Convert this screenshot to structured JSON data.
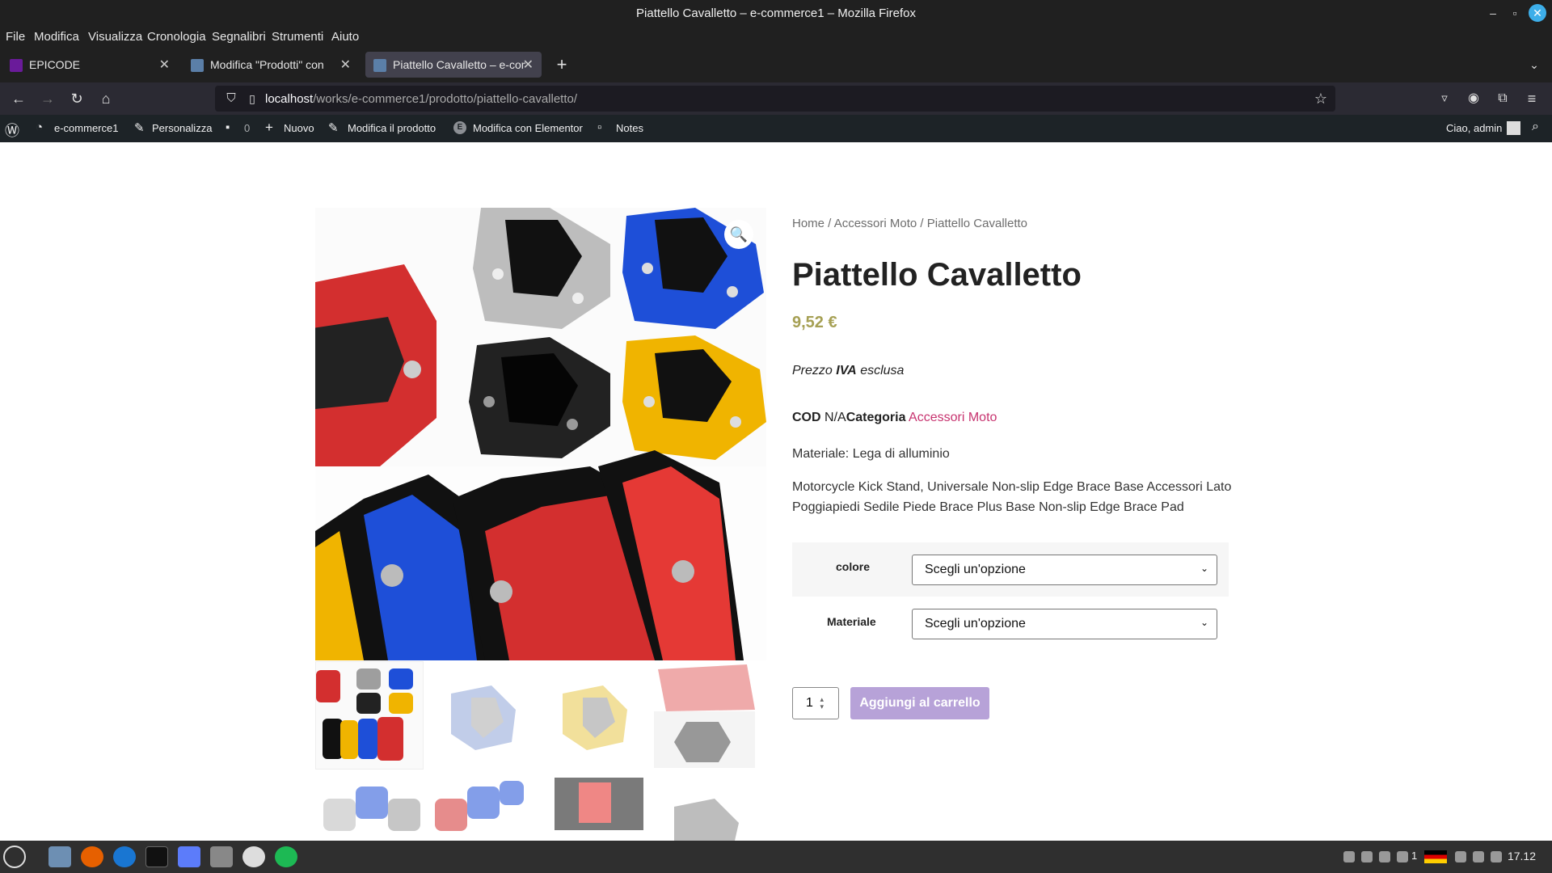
{
  "window": {
    "title": "Piattello Cavalletto – e-commerce1 – Mozilla Firefox"
  },
  "menu": [
    "File",
    "Modifica",
    "Visualizza",
    "Cronologia",
    "Segnalibri",
    "Strumenti",
    "Aiuto"
  ],
  "tabs": [
    {
      "label": "EPICODE"
    },
    {
      "label": "Modifica \"Prodotti\" con Ele"
    },
    {
      "label": "Piattello Cavalletto – e-com"
    }
  ],
  "url": {
    "host": "localhost",
    "path": "/works/e-commerce1/prodotto/piattello-cavalletto/"
  },
  "wpbar": {
    "site": "e-commerce1",
    "customize": "Personalizza",
    "comments": "0",
    "new": "Nuovo",
    "edit_product": "Modifica il prodotto",
    "elementor": "Modifica con Elementor",
    "notes": "Notes",
    "greeting": "Ciao, admin"
  },
  "product": {
    "breadcrumb": [
      "Home",
      "Accessori Moto",
      "Piattello Cavalletto"
    ],
    "title": "Piattello Cavalletto",
    "price": "9,52 €",
    "vat_prefix": "Prezzo",
    "vat_bold": "IVA",
    "vat_suffix": "esclusa",
    "sku_label": "COD",
    "sku_value": "N/A",
    "category_label": "Categoria",
    "category_value": "Accessori Moto",
    "material": "Materiale: Lega di alluminio",
    "description": "Motorcycle Kick Stand, Universale Non-slip Edge Brace Base Accessori Lato Poggiapiedi Sedile Piede Brace Plus Base Non-slip Edge Brace Pad",
    "variations": [
      {
        "label": "colore",
        "value": "Scegli un'opzione"
      },
      {
        "label": "Materiale",
        "value": "Scegli un'opzione"
      }
    ],
    "quantity": "1",
    "add_to_cart": "Aggiungi al carrello"
  },
  "taskbar": {
    "clock": "17.12",
    "workspace": "1"
  },
  "colors": {
    "accent_link": "#c7336f",
    "price": "#a6a054",
    "button": "#b7a2d8",
    "wp_bar": "#1d2327"
  }
}
